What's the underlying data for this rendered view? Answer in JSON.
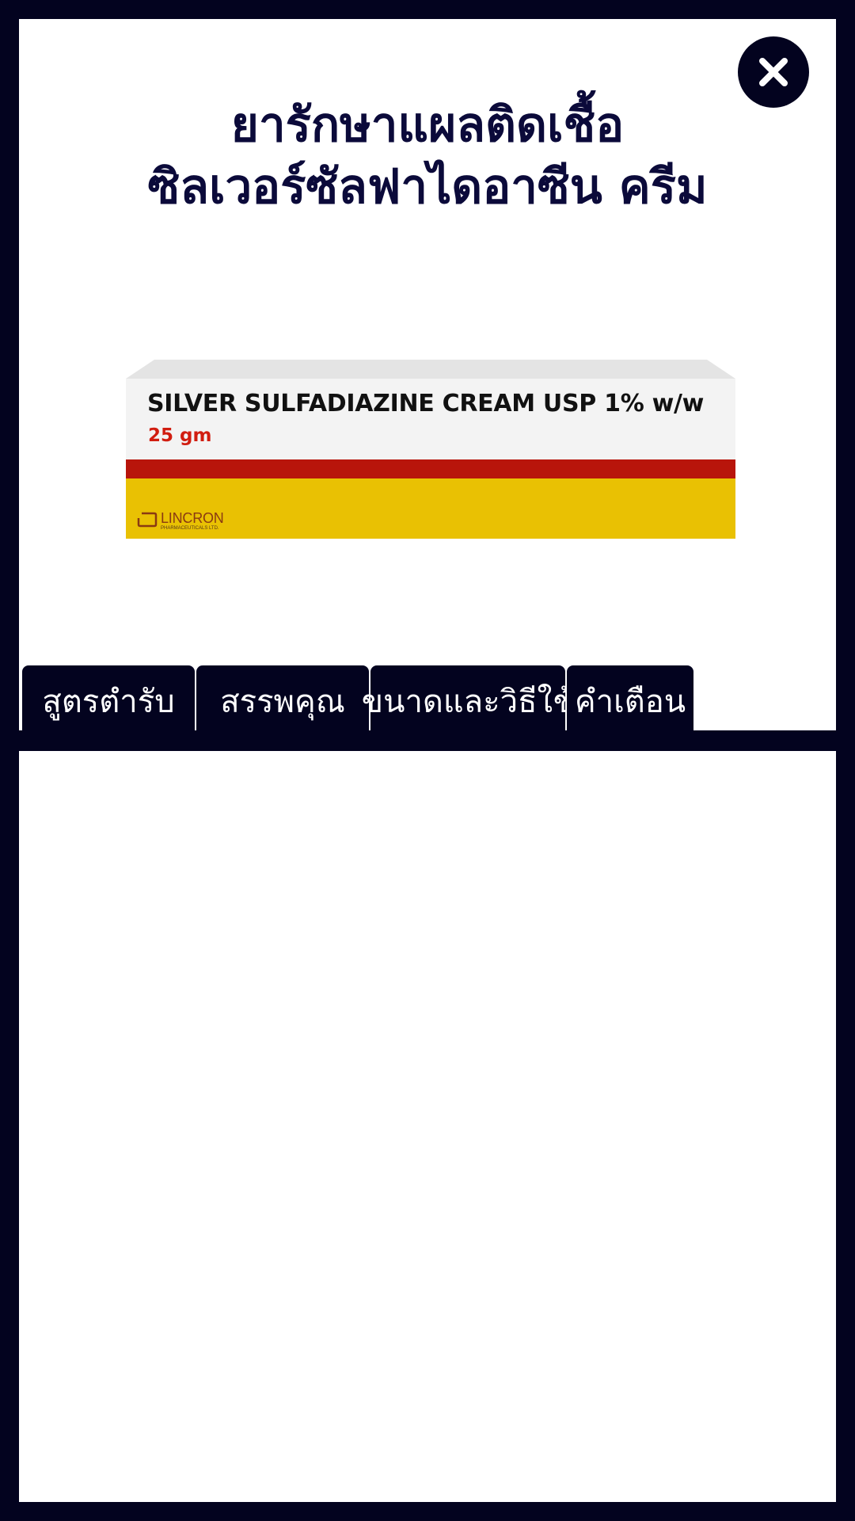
{
  "header": {
    "title_line1": "ยารักษาแผลติดเชื้อ",
    "title_line2": "ซิลเวอร์ซัลฟาไดอาซีน ครีม",
    "close_icon": "close-icon"
  },
  "product": {
    "name": "SILVER SULFADIAZINE CREAM USP 1% w/w",
    "size": "25 gm",
    "brand": "LINCRON",
    "brand_sub": "PHARMACEUTICALS LTD."
  },
  "tabs": [
    {
      "label": "สูตรตำรับ"
    },
    {
      "label": "สรรพคุณ"
    },
    {
      "label": "ขนาดและวิธีใช้"
    },
    {
      "label": "คำเตือน"
    }
  ],
  "colors": {
    "background": "#03031f",
    "panel": "#ffffff",
    "title": "#0b0a3a",
    "stripe_red": "#b8150b",
    "stripe_yellow": "#e9c103",
    "size_text": "#d11d10"
  }
}
